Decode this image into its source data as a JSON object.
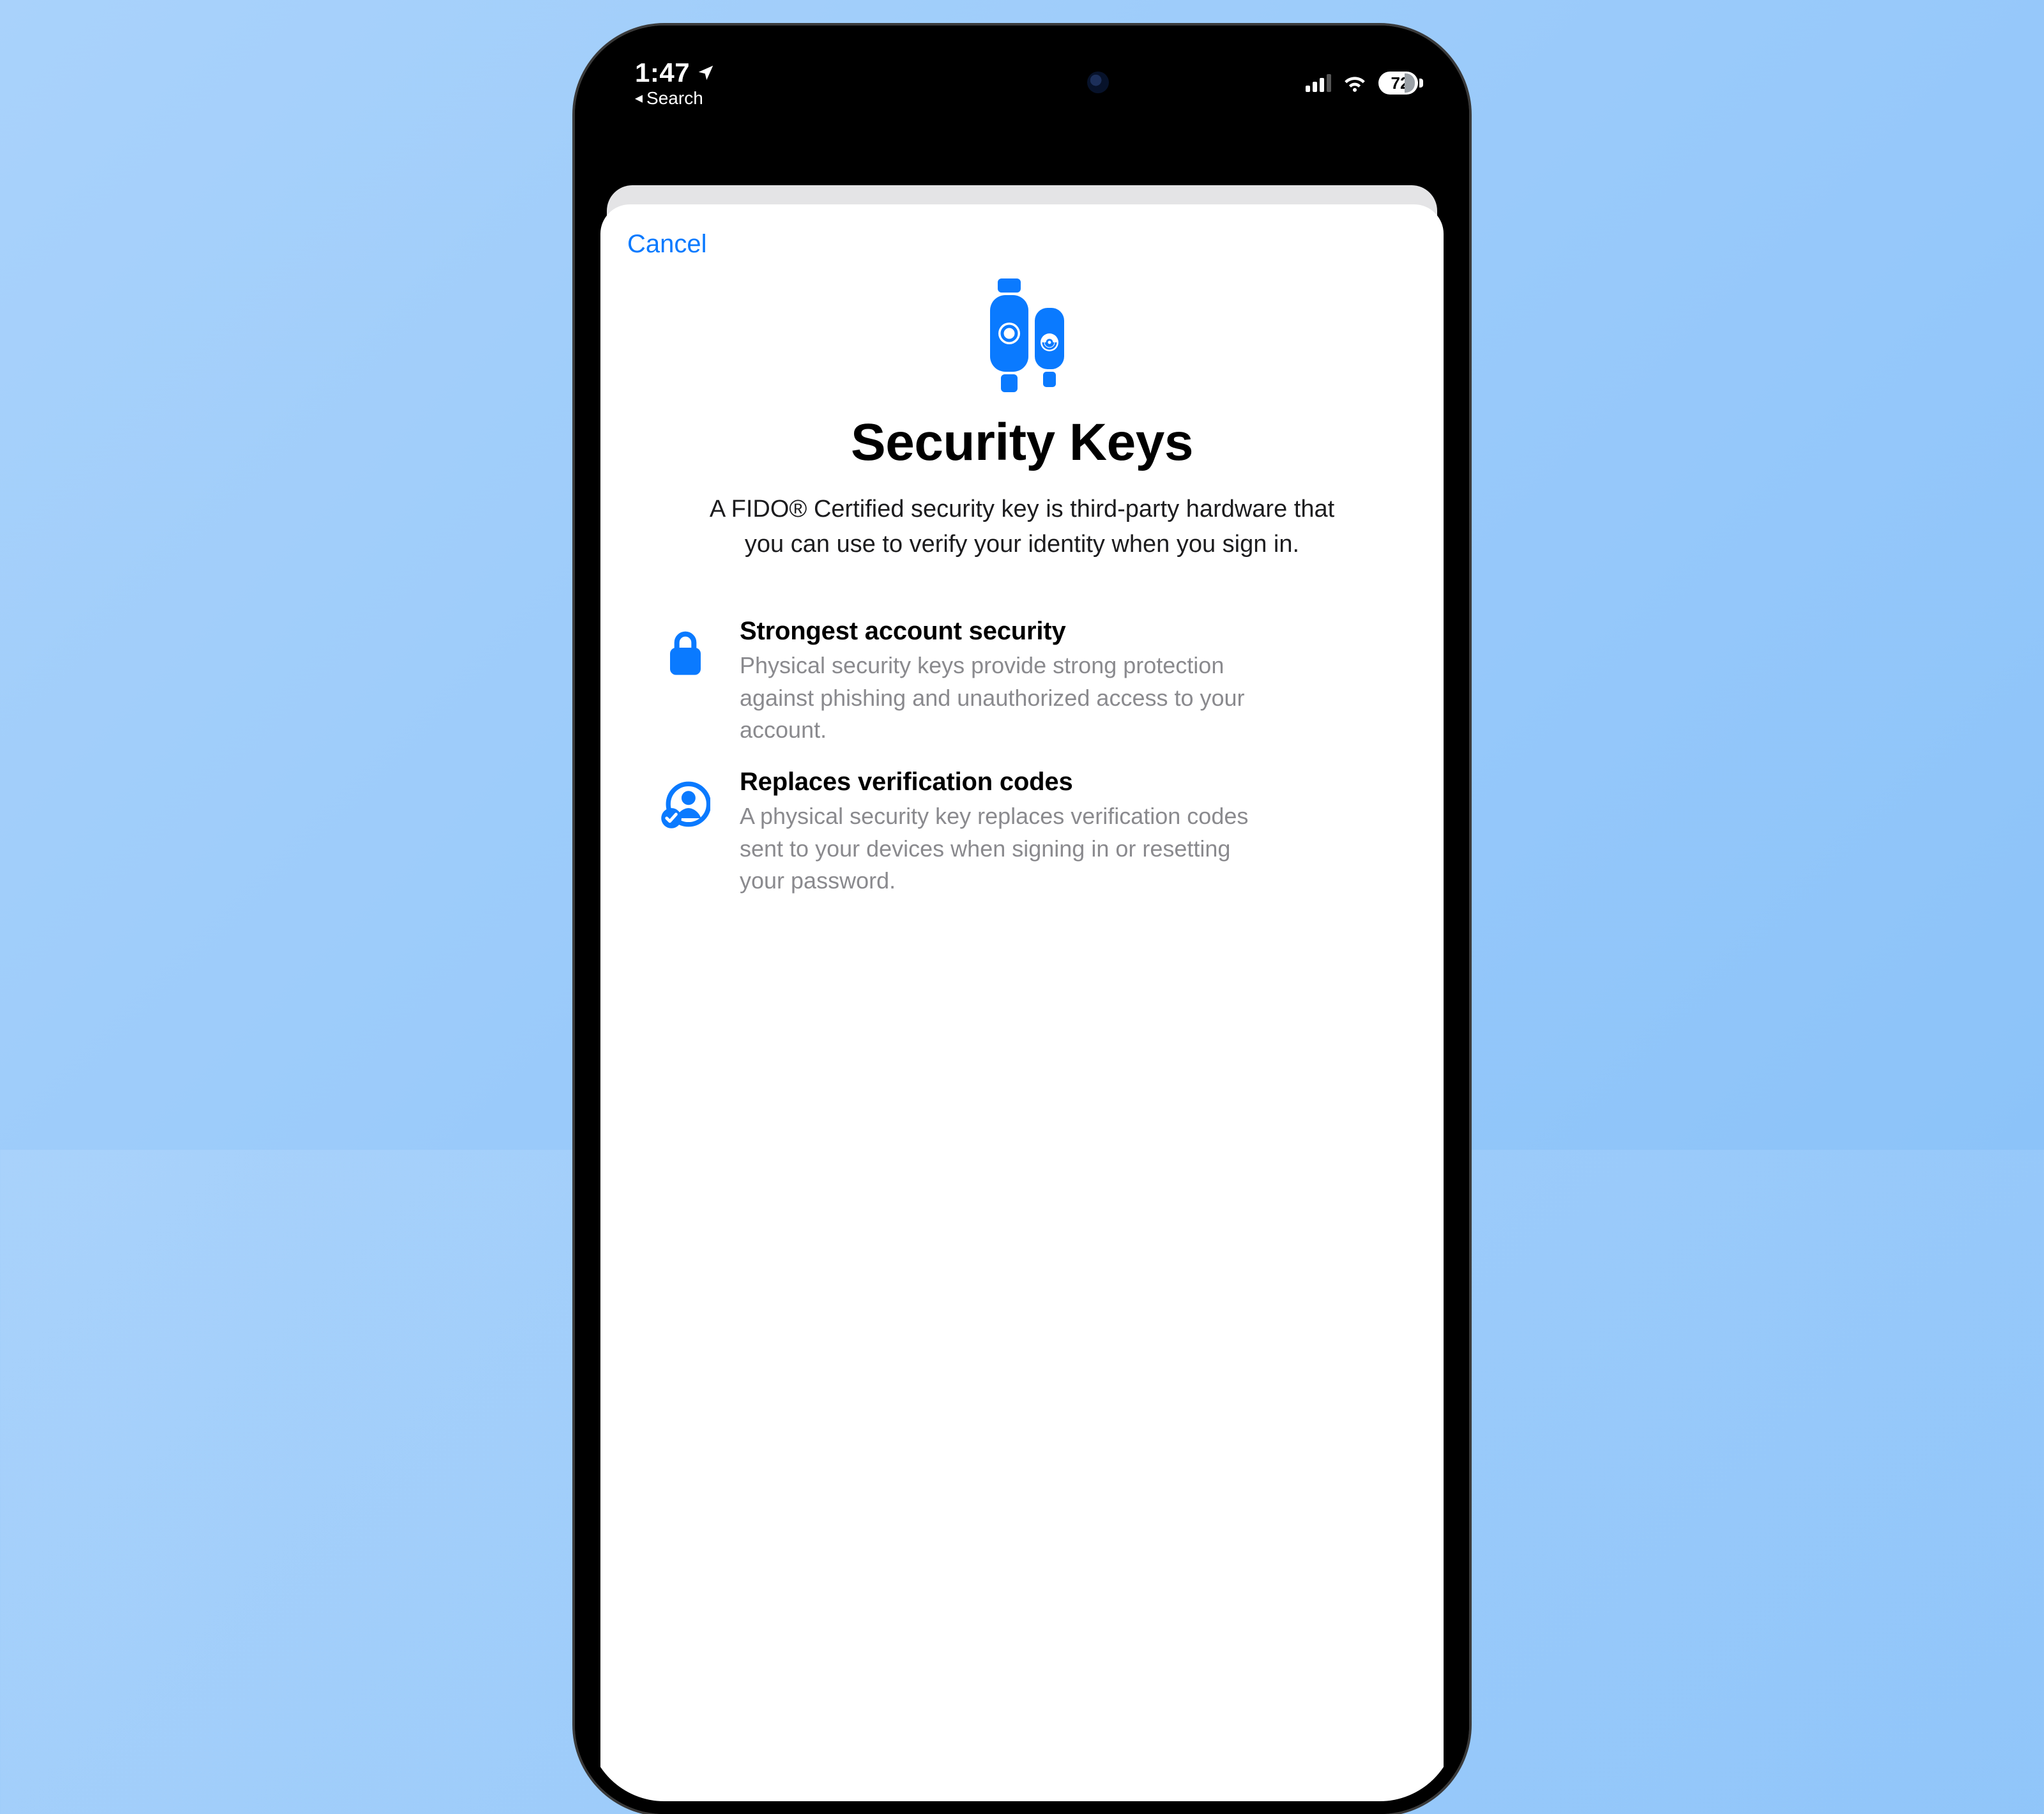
{
  "colors": {
    "accent": "#0a7aff",
    "text_secondary": "#8a8a8e"
  },
  "status": {
    "time": "1:47",
    "breadcrumb_label": "Search",
    "battery_percent": "72"
  },
  "sheet": {
    "cancel_label": "Cancel",
    "title": "Security Keys",
    "subtitle": "A FIDO® Certified security key is third-party hardware that you can use to verify your identity when you sign in.",
    "features": [
      {
        "icon": "lock-icon",
        "title": "Strongest account security",
        "desc": "Physical security keys provide strong protection against phishing and unauthorized access to your account."
      },
      {
        "icon": "person-check-icon",
        "title": "Replaces verification codes",
        "desc": "A physical security key replaces verification codes sent to your devices when signing in or resetting your password."
      }
    ]
  }
}
